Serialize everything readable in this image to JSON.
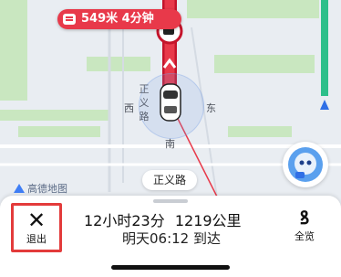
{
  "map": {
    "distance_badge": "549米 4分钟",
    "road_vertical": "正义路",
    "dir_west": "西",
    "dir_east": "东",
    "dir_south": "南",
    "current_road": "正义路",
    "provider": "高德地图",
    "icons": {
      "badge": "message-icon",
      "car": "car-icon",
      "compass": "compass-icon",
      "avatar": "assistant-avatar-icon",
      "logo": "amap-logo-icon"
    },
    "colors": {
      "route_red": "#e8394a",
      "route_red_dark": "#c4142b",
      "green_area": "#c9e7c0",
      "water": "#c5d6f0",
      "road": "#ffffff",
      "accent_blue": "#2f6fe6"
    }
  },
  "panel": {
    "exit_label": "退出",
    "exit_icon": "close-icon",
    "duration": "12小时23分",
    "distance": "1219公里",
    "arrival": "明天06:12 到达",
    "overview_label": "全览",
    "overview_icon": "route-overview-icon"
  }
}
